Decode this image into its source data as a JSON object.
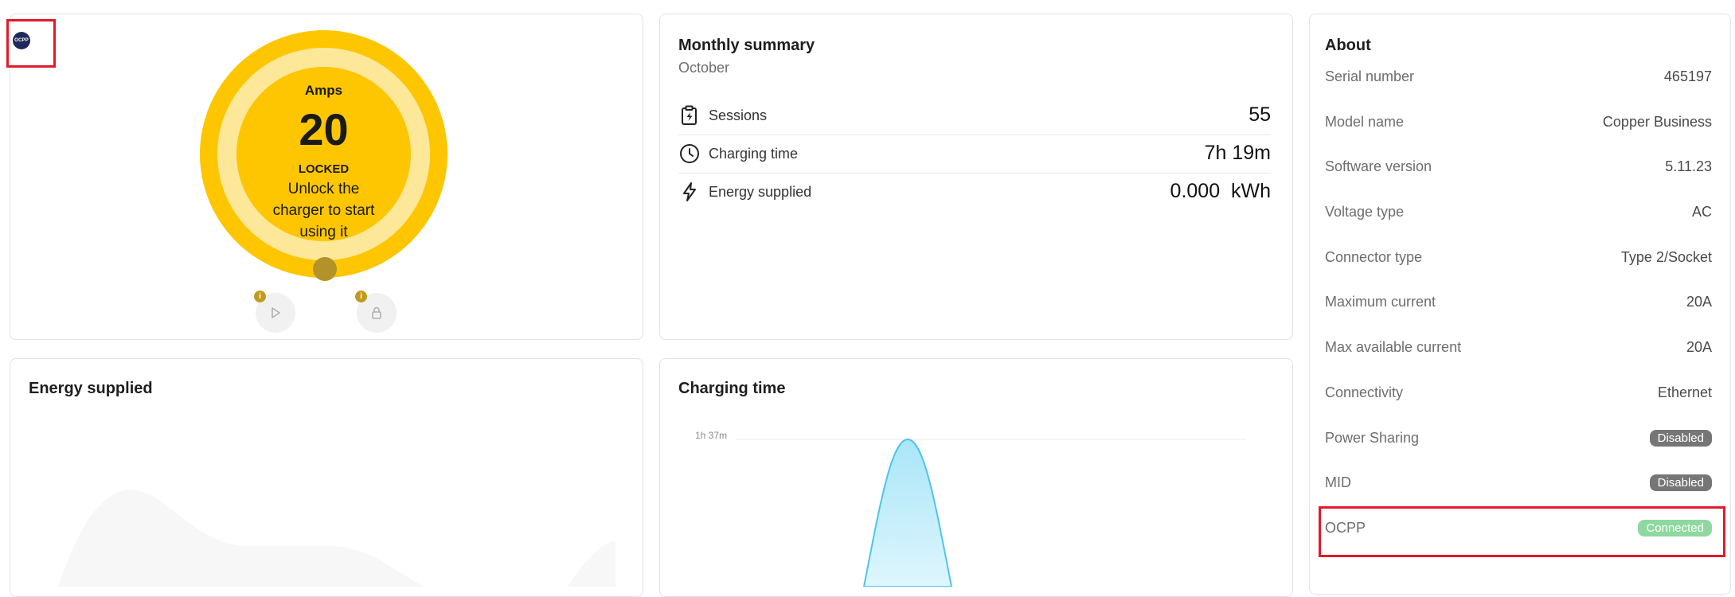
{
  "charger": {
    "logo_text": "OCPP",
    "amps_label": "Amps",
    "amps_value": "20",
    "status": "LOCKED",
    "message_line1": "Unlock the",
    "message_line2": "charger to start",
    "message_line3": "using it",
    "accent_color": "#fdc600"
  },
  "summary": {
    "title": "Monthly summary",
    "month": "October",
    "rows": [
      {
        "icon": "clipboard-bolt-icon",
        "label": "Sessions",
        "value": "55"
      },
      {
        "icon": "clock-icon",
        "label": "Charging time",
        "value": "7h 19m"
      },
      {
        "icon": "bolt-icon",
        "label": "Energy supplied",
        "value": "0.000  kWh"
      }
    ]
  },
  "about": {
    "title": "About",
    "rows": [
      {
        "label": "Serial number",
        "value": "465197"
      },
      {
        "label": "Model name",
        "value": "Copper Business"
      },
      {
        "label": "Software version",
        "value": "5.11.23"
      },
      {
        "label": "Voltage type",
        "value": "AC"
      },
      {
        "label": "Connector type",
        "value": "Type 2/Socket"
      },
      {
        "label": "Maximum current",
        "value": "20A"
      },
      {
        "label": "Max available current",
        "value": "20A"
      },
      {
        "label": "Connectivity",
        "value": "Ethernet"
      },
      {
        "label": "Power Sharing",
        "badge": "Disabled"
      },
      {
        "label": "MID",
        "badge": "Disabled"
      },
      {
        "label": "OCPP",
        "badge": "Connected"
      }
    ]
  },
  "energy_chart": {
    "title": "Energy supplied"
  },
  "time_chart": {
    "title": "Charging time",
    "y_tick": "1h 37m",
    "fill_color": "#c8eefa",
    "line_color": "#4cc6ea"
  }
}
